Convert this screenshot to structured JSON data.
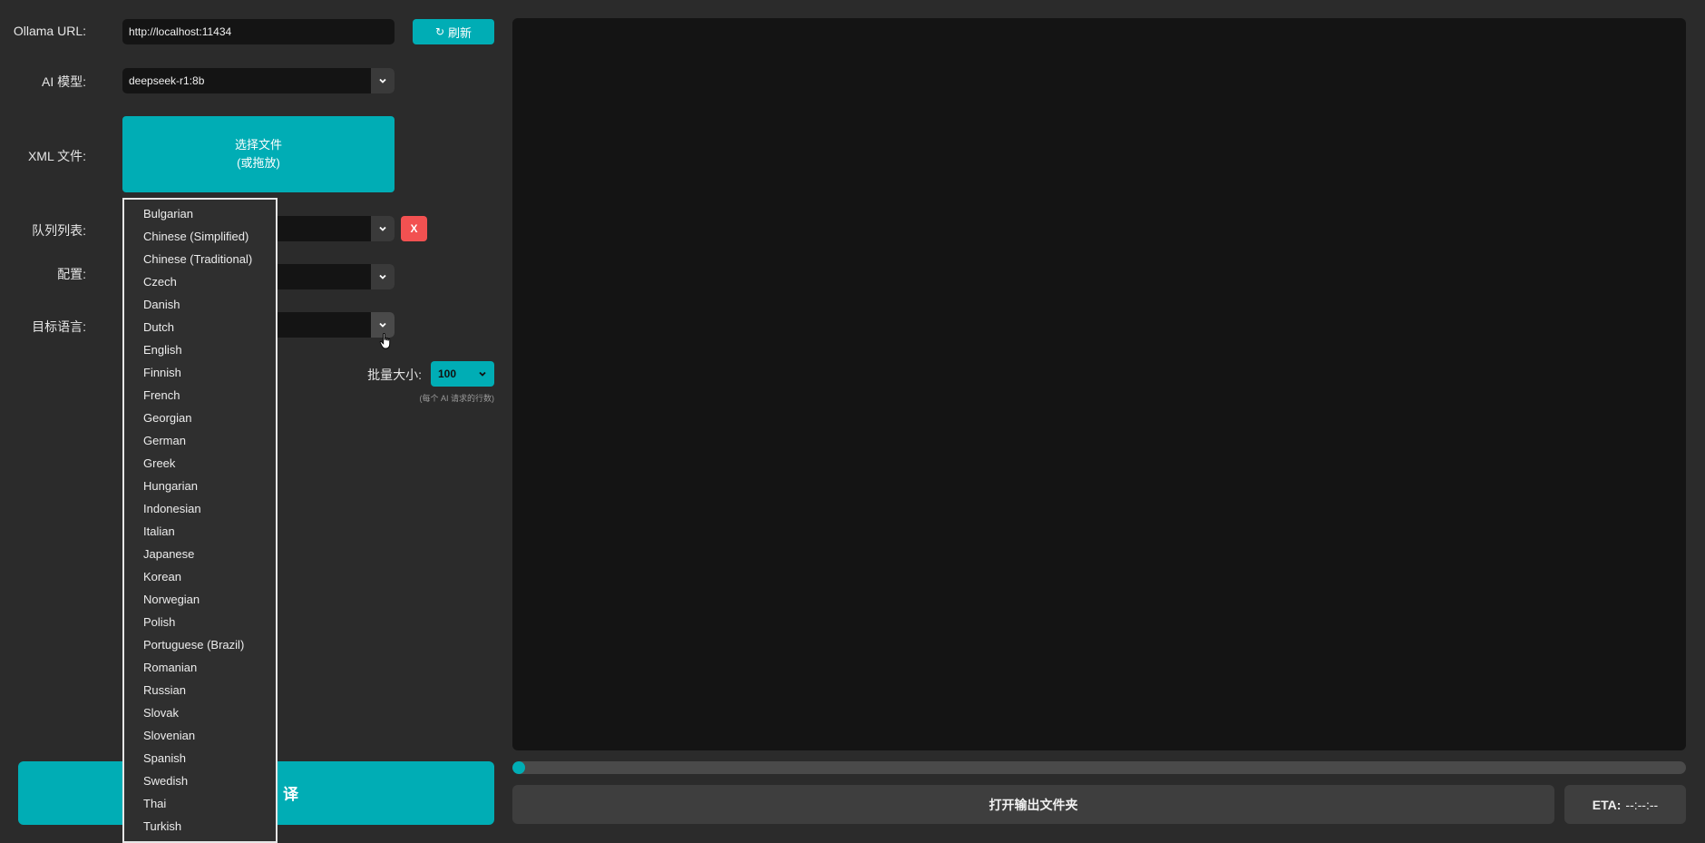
{
  "ollama": {
    "label": "Ollama URL:",
    "value": "http://localhost:11434",
    "refresh_label": "刷新"
  },
  "model": {
    "label": "AI 模型:",
    "value": "deepseek-r1:8b"
  },
  "xml": {
    "label": "XML 文件:",
    "button_line1": "选择文件",
    "button_line2": "(或拖放)"
  },
  "queue": {
    "label": "队列列表:",
    "clear_label": "X"
  },
  "config": {
    "label": "配置:"
  },
  "target": {
    "label": "目标语言:"
  },
  "batch": {
    "label": "批量大小:",
    "value": "100",
    "hint": "(每个 AI 请求的行数)"
  },
  "start": {
    "label_fragment": "译"
  },
  "languages": [
    "Bulgarian",
    "Chinese (Simplified)",
    "Chinese (Traditional)",
    "Czech",
    "Danish",
    "Dutch",
    "English",
    "Finnish",
    "French",
    "Georgian",
    "German",
    "Greek",
    "Hungarian",
    "Indonesian",
    "Italian",
    "Japanese",
    "Korean",
    "Norwegian",
    "Polish",
    "Portuguese (Brazil)",
    "Romanian",
    "Russian",
    "Slovak",
    "Slovenian",
    "Spanish",
    "Swedish",
    "Thai",
    "Turkish"
  ],
  "progress": {
    "value": 0.01
  },
  "output": {
    "open_folder_label": "打开输出文件夹",
    "eta_label": "ETA:",
    "eta_value": "--:--:--"
  },
  "colors": {
    "accent": "#00adb5",
    "danger": "#f25151",
    "background": "#2b2b2b",
    "field": "#141414"
  }
}
